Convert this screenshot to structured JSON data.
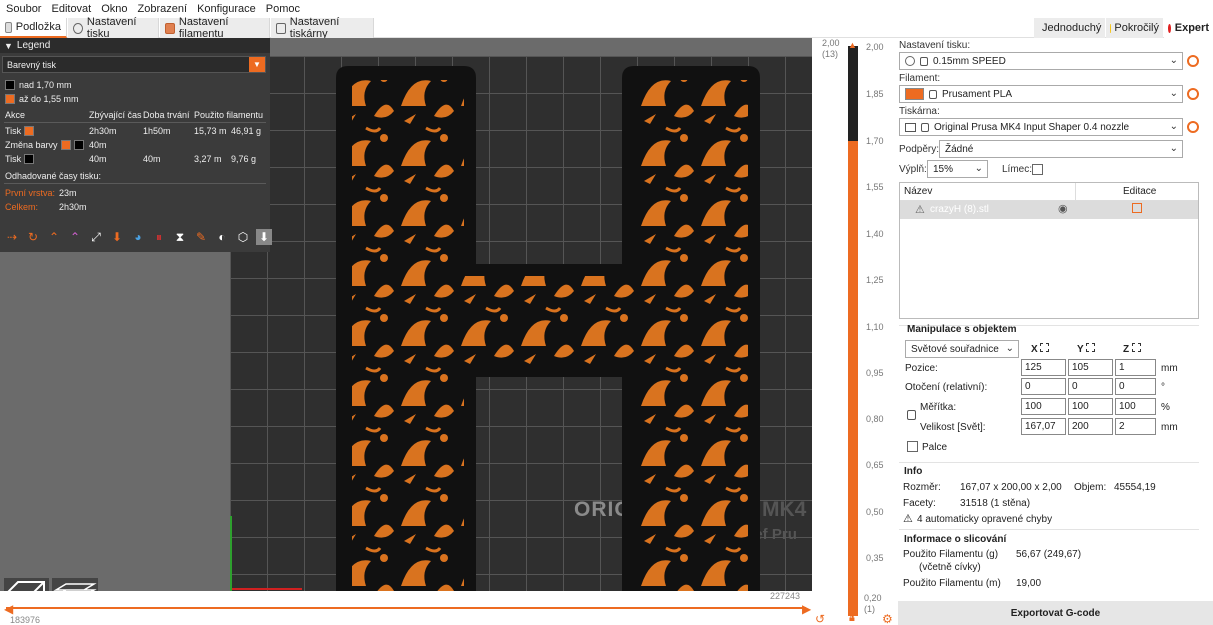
{
  "menu": [
    "Soubor",
    "Editovat",
    "Okno",
    "Zobrazení",
    "Konfigurace",
    "Pomoc"
  ],
  "tabs": {
    "platter": "Podložka",
    "print_settings": "Nastavení tisku",
    "filament_settings": "Nastavení filamentu",
    "printer_settings": "Nastavení tiskárny"
  },
  "modes": {
    "simple": "Jednoduchý",
    "advanced": "Pokročilý",
    "expert": "Expert",
    "simple_color": "#3cc13c",
    "advanced_color": "#f5c518",
    "expert_color": "#e02020"
  },
  "legend": {
    "title": "Legend",
    "view_type": "Barevný tisk",
    "ranges": [
      {
        "label": "nad 1,70 mm",
        "color": "#000000"
      },
      {
        "label": "až do 1,55 mm",
        "color": "#ed6b21"
      }
    ],
    "table_headers": {
      "action": "Akce",
      "remaining": "Zbývající čas",
      "duration": "Doba trvání",
      "used": "Použito filamentu"
    },
    "rows": [
      {
        "action": "Tisk",
        "remaining": "2h30m",
        "duration": "1h50m",
        "length": "15,73 m",
        "weight": "46,91 g"
      },
      {
        "action": "Změna barvy",
        "remaining": "40m",
        "duration": "",
        "length": "",
        "weight": ""
      },
      {
        "action": "Tisk",
        "remaining": "40m",
        "duration": "40m",
        "length": "3,27 m",
        "weight": "9,76 g"
      }
    ],
    "estimated_title": "Odhadované časy tisku:",
    "first_layer_label": "První vrstva:",
    "first_layer_value": "23m",
    "total_label": "Celkem:",
    "total_value": "2h30m"
  },
  "viewport": {
    "bed_logo": "ORIG",
    "bed_logo2": "MK4",
    "bed_sub": "sef Pru"
  },
  "hslider": {
    "left_value": "183976",
    "right_value": "227243"
  },
  "vslider": {
    "top_value": "2,00",
    "top_layer": "(13)",
    "bottom_value": "0,20",
    "bottom_layer": "(1)",
    "ticks": [
      "2,00",
      "1,85",
      "1,70",
      "1,55",
      "1,40",
      "1,25",
      "1,10",
      "0,95",
      "0,80",
      "0,65",
      "0,50",
      "0,35",
      "0,20"
    ]
  },
  "panel": {
    "print_label": "Nastavení tisku:",
    "print_value": "0.15mm SPEED",
    "filament_label": "Filament:",
    "filament_value": "Prusament PLA",
    "filament_color": "#ed6b21",
    "printer_label": "Tiskárna:",
    "printer_value": "Original Prusa MK4 Input Shaper 0.4 nozzle",
    "supports_label": "Podpěry:",
    "supports_value": "Žádné",
    "infill_label": "Výplň:",
    "infill_value": "15%",
    "brim_label": "Límec:",
    "list_name": "Název",
    "list_edit": "Editace",
    "object_name": "crazyH (8).stl",
    "manip_title": "Manipulace s objektem",
    "coord_value": "Světové souřadnice",
    "axis_x": "X",
    "axis_y": "Y",
    "axis_z": "Z",
    "position_label": "Pozice:",
    "position": [
      "125",
      "105",
      "1"
    ],
    "position_unit": "mm",
    "rotation_label": "Otočení (relativní):",
    "rotation": [
      "0",
      "0",
      "0"
    ],
    "rotation_unit": "°",
    "scale_label": "Měřítka:",
    "scale": [
      "100",
      "100",
      "100"
    ],
    "scale_unit": "%",
    "size_label": "Velikost [Svět]:",
    "size": [
      "167,07",
      "200",
      "2"
    ],
    "size_unit": "mm",
    "inches_label": "Palce",
    "info_title": "Info",
    "size_info_label": "Rozměr:",
    "size_info_value": "167,07 x 200,00 x 2,00",
    "volume_label": "Objem:",
    "volume_value": "45554,19",
    "facets_label": "Facety:",
    "facets_value": "31518 (1 stěna)",
    "errors_text": "4 automaticky opravené chyby",
    "slice_title": "Informace o slicování",
    "filament_g_label": "Použito Filamentu (g)",
    "filament_g_sub": "(včetně cívky)",
    "filament_g_value": "56,67 (249,67)",
    "filament_m_label": "Použito Filamentu (m)",
    "filament_m_value": "19,00",
    "export_label": "Exportovat G-code"
  }
}
